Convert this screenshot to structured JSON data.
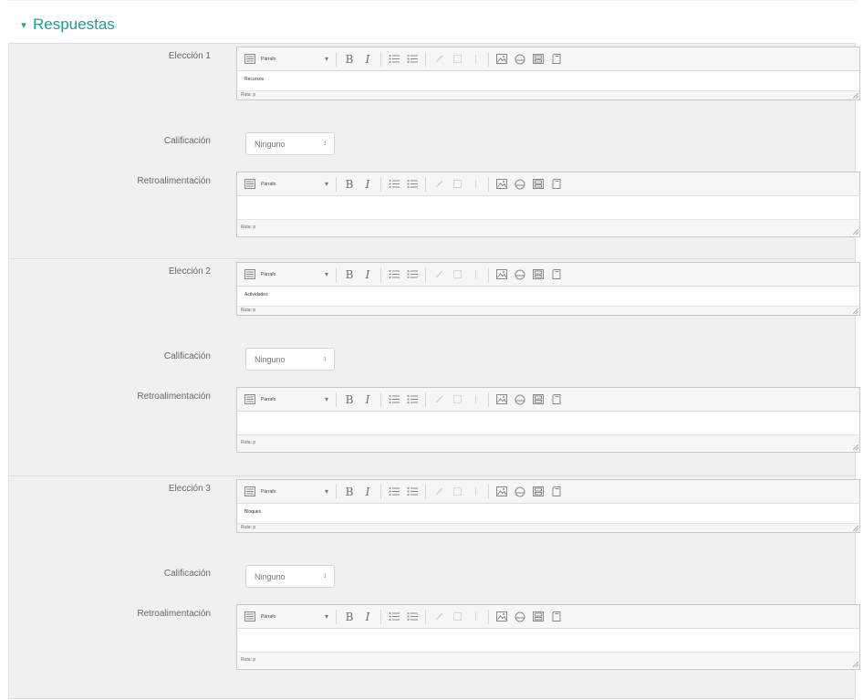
{
  "section": {
    "title": "Respuestas",
    "toggle_icon": "chevron-down-icon"
  },
  "toolbar": {
    "format_value": "Párrafo",
    "bold_label": "B",
    "italic_label": "I"
  },
  "grade_label": "Calificación",
  "feedback_label": "Retroalimentación",
  "choices": [
    {
      "label": "Elección 1",
      "answer_text": "Recursos",
      "answer_path": "Ruta: p",
      "grade_value": "Ninguno",
      "feedback_text": "",
      "feedback_path": "Ruta: p"
    },
    {
      "label": "Elección 2",
      "answer_text": "Actividades",
      "answer_path": "Ruta: p",
      "grade_value": "Ninguno",
      "feedback_text": "",
      "feedback_path": "Ruta: p"
    },
    {
      "label": "Elección 3",
      "answer_text": "Bloques",
      "answer_path": "Ruta: p",
      "grade_value": "Ninguno",
      "feedback_text": "",
      "feedback_path": "Ruta: p"
    }
  ]
}
